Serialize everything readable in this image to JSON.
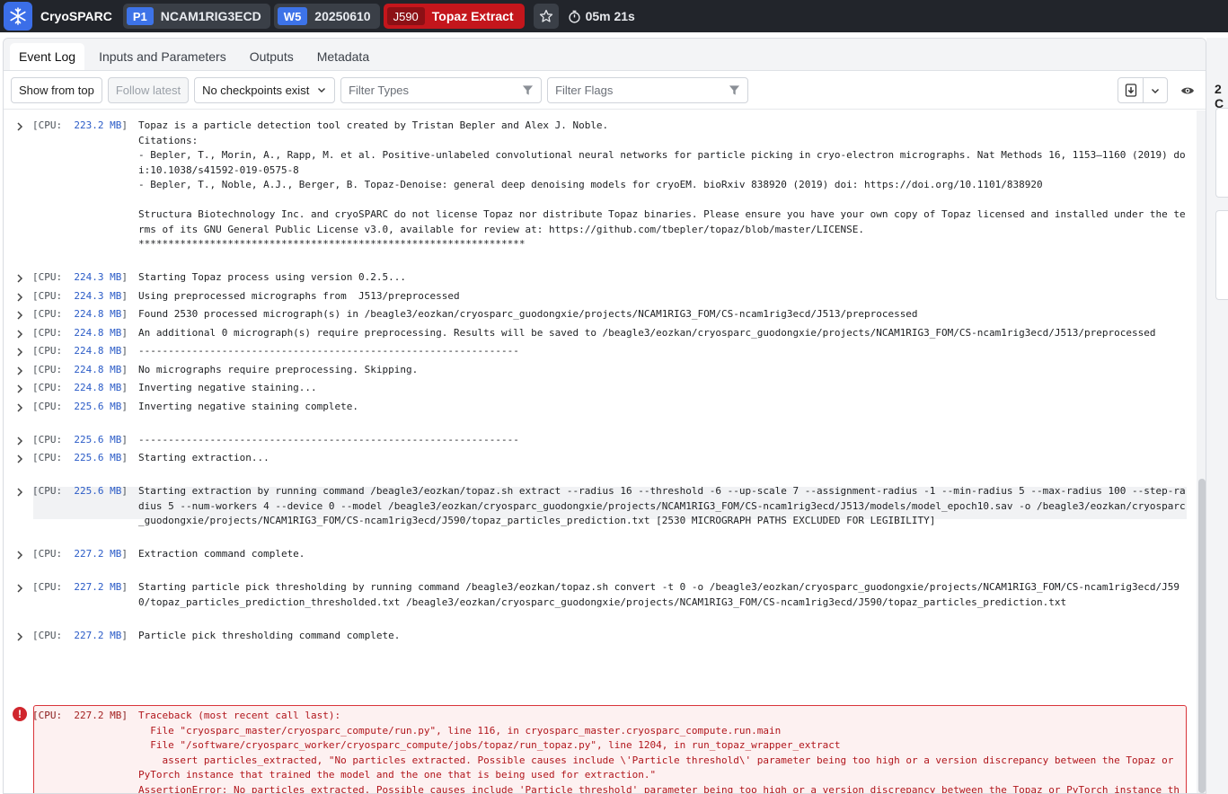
{
  "topbar": {
    "brand": "CryoSPARC",
    "project": {
      "id": "P1",
      "name": "NCAM1RIG3ECD"
    },
    "workspace": {
      "id": "W5",
      "name": "20250610"
    },
    "job": {
      "id": "J590",
      "name": "Topaz Extract"
    },
    "timer": "05m 21s"
  },
  "tabs": [
    "Event Log",
    "Inputs and Parameters",
    "Outputs",
    "Metadata"
  ],
  "toolbar": {
    "show_from_top": "Show from top",
    "follow_latest": "Follow latest",
    "checkpoints": "No checkpoints exist",
    "filter_types_placeholder": "Filter Types",
    "filter_flags_placeholder": "Filter Flags"
  },
  "right_panel": {
    "count": "2 C"
  },
  "log_entries": [
    {
      "cpu": "223.2 MB",
      "message": "Topaz is a particle detection tool created by Tristan Bepler and Alex J. Noble.\nCitations:\n- Bepler, T., Morin, A., Rapp, M. et al. Positive-unlabeled convolutional neural networks for particle picking in cryo-electron micrographs. Nat Methods 16, 1153–1160 (2019) doi:10.1038/s41592-019-0575-8\n- Bepler, T., Noble, A.J., Berger, B. Topaz-Denoise: general deep denoising models for cryoEM. bioRxiv 838920 (2019) doi: https://doi.org/10.1101/838920\n\nStructura Biotechnology Inc. and cryoSPARC do not license Topaz nor distribute Topaz binaries. Please ensure you have your own copy of Topaz licensed and installed under the terms of its GNU General Public License v3.0, available for review at: https://github.com/tbepler/topaz/blob/master/LICENSE.\n*****************************************************************"
    },
    {
      "cpu": "224.3 MB",
      "message": "Starting Topaz process using version 0.2.5..."
    },
    {
      "cpu": "224.3 MB",
      "message": "Using preprocessed micrographs from  J513/preprocessed"
    },
    {
      "cpu": "224.8 MB",
      "message": "Found 2530 processed micrograph(s) in /beagle3/eozkan/cryosparc_guodongxie/projects/NCAM1RIG3_FOM/CS-ncam1rig3ecd/J513/preprocessed"
    },
    {
      "cpu": "224.8 MB",
      "message": "An additional 0 micrograph(s) require preprocessing. Results will be saved to /beagle3/eozkan/cryosparc_guodongxie/projects/NCAM1RIG3_FOM/CS-ncam1rig3ecd/J513/preprocessed"
    },
    {
      "cpu": "224.8 MB",
      "message": "----------------------------------------------------------------"
    },
    {
      "cpu": "224.8 MB",
      "message": "No micrographs require preprocessing. Skipping."
    },
    {
      "cpu": "224.8 MB",
      "message": "Inverting negative staining..."
    },
    {
      "cpu": "225.6 MB",
      "message": "Inverting negative staining complete."
    },
    {
      "cpu": "225.6 MB",
      "message": "----------------------------------------------------------------"
    },
    {
      "cpu": "225.6 MB",
      "message": "Starting extraction..."
    },
    {
      "cpu": "225.6 MB",
      "message": "Starting extraction by running command /beagle3/eozkan/topaz.sh extract --radius 16 --threshold -6 --up-scale 7 --assignment-radius -1 --min-radius 5 --max-radius 100 --step-radius 5 --num-workers 4 --device 0 --model /beagle3/eozkan/cryosparc_guodongxie/projects/NCAM1RIG3_FOM/CS-ncam1rig3ecd/J513/models/model_epoch10.sav -o /beagle3/eozkan/cryosparc_guodongxie/projects/NCAM1RIG3_FOM/CS-ncam1rig3ecd/J590/topaz_particles_prediction.txt [2530 MICROGRAPH PATHS EXCLUDED FOR LEGIBILITY]"
    },
    {
      "cpu": "227.2 MB",
      "message": "Extraction command complete."
    },
    {
      "cpu": "227.2 MB",
      "message": "Starting particle pick thresholding by running command /beagle3/eozkan/topaz.sh convert -t 0 -o /beagle3/eozkan/cryosparc_guodongxie/projects/NCAM1RIG3_FOM/CS-ncam1rig3ecd/J590/topaz_particles_prediction_thresholded.txt /beagle3/eozkan/cryosparc_guodongxie/projects/NCAM1RIG3_FOM/CS-ncam1rig3ecd/J590/topaz_particles_prediction.txt"
    },
    {
      "cpu": "227.2 MB",
      "message": "Particle pick thresholding command complete."
    }
  ],
  "error_entry": {
    "cpu": "227.2 MB",
    "message": "Traceback (most recent call last):\n  File \"cryosparc_master/cryosparc_compute/run.py\", line 116, in cryosparc_master.cryosparc_compute.run.main\n  File \"/software/cryosparc_worker/cryosparc_compute/jobs/topaz/run_topaz.py\", line 1204, in run_topaz_wrapper_extract\n    assert particles_extracted, \"No particles extracted. Possible causes include \\'Particle threshold\\' parameter being too high or a version discrepancy between the Topaz or PyTorch instance that trained the model and the one that is being used for extraction.\"\nAssertionError: No particles extracted. Possible causes include 'Particle threshold' parameter being too high or a version discrepancy between the Topaz or PyTorch instance that trained the model and the one that is being used for extraction."
  },
  "colors": {
    "topbar_bg": "#22252b",
    "badge_blue": "#3d73e8",
    "job_red": "#c4161c",
    "error_red": "#d0262d"
  },
  "icons": [
    "snowflake-logo-icon",
    "star-icon",
    "stopwatch-icon",
    "chevron-down-icon",
    "filter-icon",
    "download-icon",
    "eye-icon",
    "chevron-right-icon",
    "error-icon"
  ]
}
